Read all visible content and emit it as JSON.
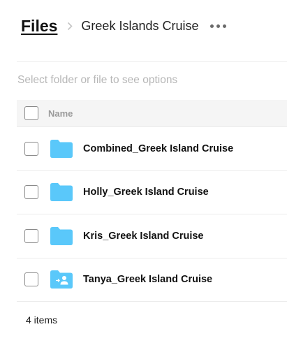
{
  "breadcrumb": {
    "root_label": "Files",
    "current_label": "Greek Islands Cruise",
    "separator_icon": "chevron-right-icon",
    "more_icon": "more-horizontal-icon"
  },
  "hint_text": "Select folder or file to see options",
  "list": {
    "header": {
      "name_label": "Name"
    },
    "items": [
      {
        "name": "Combined_Greek Island Cruise",
        "icon": "folder-icon"
      },
      {
        "name": "Holly_Greek Island Cruise",
        "icon": "folder-icon"
      },
      {
        "name": "Kris_Greek Island Cruise",
        "icon": "folder-icon"
      },
      {
        "name": "Tanya_Greek Island Cruise",
        "icon": "shared-folder-icon"
      }
    ]
  },
  "footer": {
    "item_count_label": "4 items"
  },
  "colors": {
    "folder": "#5ac8fa",
    "hint": "#b7b7b7",
    "header_bg": "#f5f5f5"
  }
}
